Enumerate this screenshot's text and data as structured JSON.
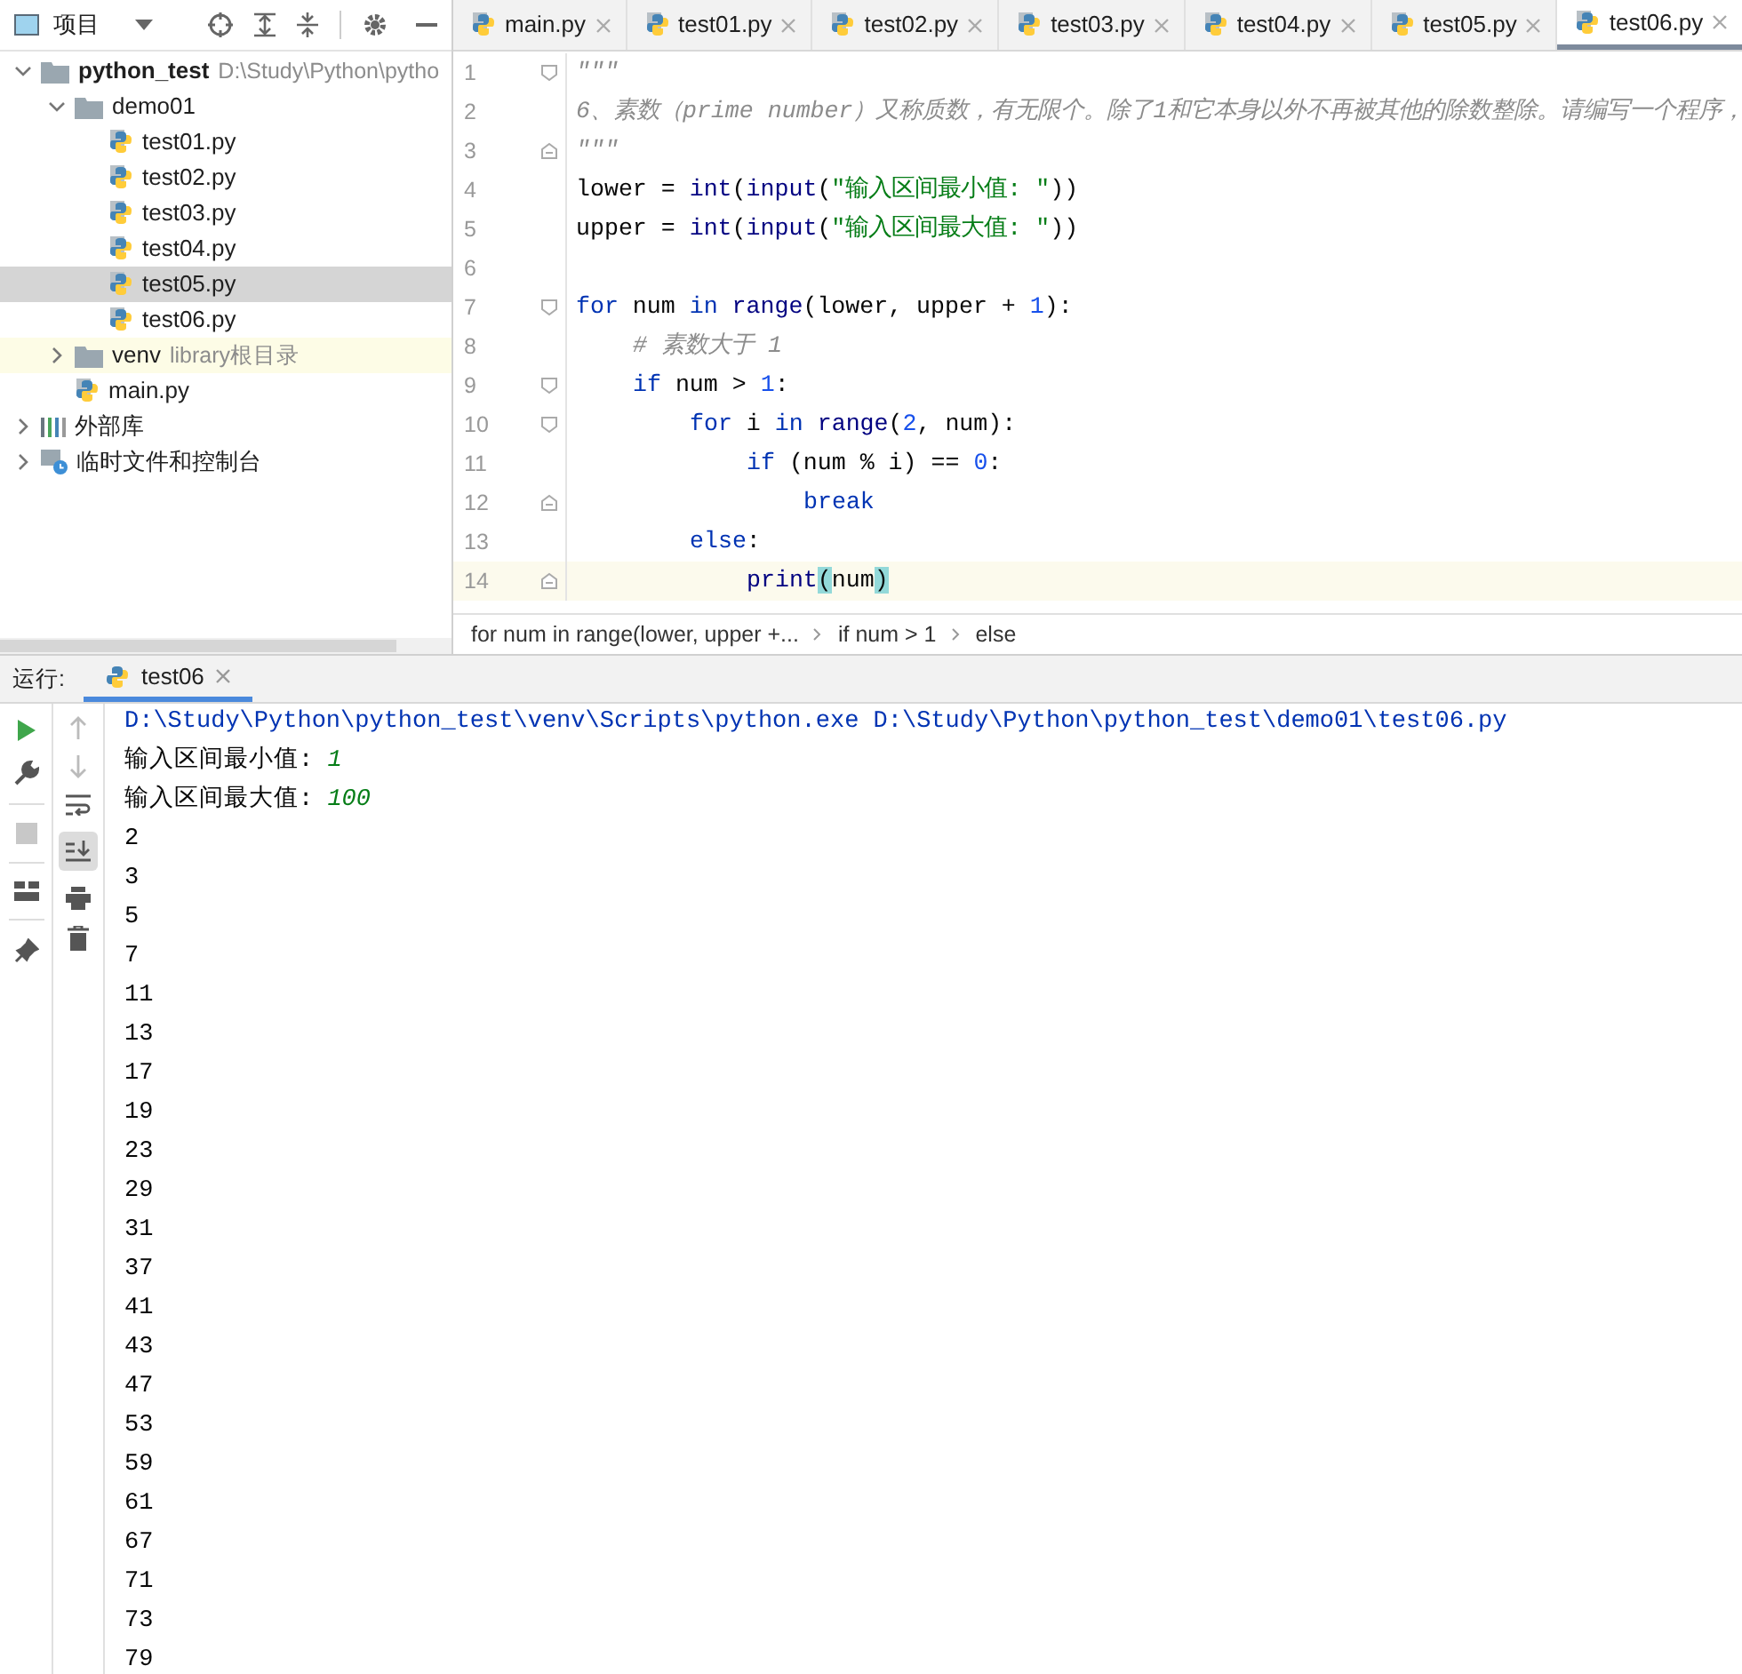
{
  "project_panel": {
    "title": "项目",
    "tree": [
      {
        "label": "python_test",
        "hint": "D:\\Study\\Python\\pytho",
        "kind": "project",
        "expanded": true,
        "selected": false,
        "children": [
          {
            "label": "demo01",
            "kind": "folder",
            "expanded": true,
            "selected": false,
            "children": [
              {
                "label": "test01.py",
                "kind": "python",
                "selected": false
              },
              {
                "label": "test02.py",
                "kind": "python",
                "selected": false
              },
              {
                "label": "test03.py",
                "kind": "python",
                "selected": false
              },
              {
                "label": "test04.py",
                "kind": "python",
                "selected": false
              },
              {
                "label": "test05.py",
                "kind": "python",
                "selected": true
              },
              {
                "label": "test06.py",
                "kind": "python",
                "selected": false
              }
            ]
          },
          {
            "label": "venv",
            "hint": "library根目录",
            "kind": "library",
            "expanded": false,
            "selected": false
          },
          {
            "label": "main.py",
            "kind": "python",
            "selected": false
          }
        ]
      },
      {
        "label": "外部库",
        "kind": "ext-lib",
        "expanded": false,
        "selected": false
      },
      {
        "label": "临时文件和控制台",
        "kind": "scratch",
        "expanded": false,
        "selected": false
      }
    ]
  },
  "editor_tabs": [
    {
      "label": "main.py",
      "selected": false
    },
    {
      "label": "test01.py",
      "selected": false
    },
    {
      "label": "test02.py",
      "selected": false
    },
    {
      "label": "test03.py",
      "selected": false
    },
    {
      "label": "test04.py",
      "selected": false
    },
    {
      "label": "test05.py",
      "selected": false
    },
    {
      "label": "test06.py",
      "selected": true
    }
  ],
  "code_lines": [
    {
      "number": "1",
      "fold_start": true,
      "tokens": [
        {
          "kind": "doc",
          "text": "\"\"\""
        }
      ]
    },
    {
      "number": "2",
      "tokens": [
        {
          "kind": "doc",
          "text": "6、素数（prime number）又称质数，有无限个。除了1和它本身以外不再被其他的除数整除。请编写一个程序，"
        }
      ]
    },
    {
      "number": "3",
      "fold_end": true,
      "tokens": [
        {
          "kind": "doc",
          "text": "\"\"\""
        }
      ]
    },
    {
      "number": "4",
      "tokens": [
        {
          "kind": "plain",
          "text": "lower = "
        },
        {
          "kind": "builtin",
          "text": "int"
        },
        {
          "kind": "plain",
          "text": "("
        },
        {
          "kind": "builtin",
          "text": "input"
        },
        {
          "kind": "plain",
          "text": "("
        },
        {
          "kind": "str",
          "text": "\"输入区间最小值: \""
        },
        {
          "kind": "plain",
          "text": "))"
        }
      ]
    },
    {
      "number": "5",
      "tokens": [
        {
          "kind": "plain",
          "text": "upper = "
        },
        {
          "kind": "builtin",
          "text": "int"
        },
        {
          "kind": "plain",
          "text": "("
        },
        {
          "kind": "builtin",
          "text": "input"
        },
        {
          "kind": "plain",
          "text": "("
        },
        {
          "kind": "str",
          "text": "\"输入区间最大值: \""
        },
        {
          "kind": "plain",
          "text": "))"
        }
      ]
    },
    {
      "number": "6"
    },
    {
      "number": "7",
      "fold_start": true,
      "tokens": [
        {
          "kind": "kw",
          "text": "for"
        },
        {
          "kind": "plain",
          "text": " num "
        },
        {
          "kind": "kw",
          "text": "in"
        },
        {
          "kind": "builtin",
          "text": " range"
        },
        {
          "kind": "plain",
          "text": "(lower, upper + "
        },
        {
          "kind": "num",
          "text": "1"
        },
        {
          "kind": "plain",
          "text": "):"
        }
      ],
      "children": [
        {
          "number": "8",
          "tokens": [
            {
              "kind": "cmt",
              "text": "# 素数大于 1"
            }
          ]
        },
        {
          "number": "9",
          "fold_start": true,
          "tokens": [
            {
              "kind": "kw",
              "text": "if"
            },
            {
              "kind": "plain",
              "text": " num > "
            },
            {
              "kind": "num",
              "text": "1"
            },
            {
              "kind": "plain",
              "text": ":"
            }
          ],
          "children": [
            {
              "number": "10",
              "fold_start": true,
              "tokens": [
                {
                  "kind": "kw",
                  "text": "for"
                },
                {
                  "kind": "plain",
                  "text": " i "
                },
                {
                  "kind": "kw",
                  "text": "in"
                },
                {
                  "kind": "builtin",
                  "text": " range"
                },
                {
                  "kind": "plain",
                  "text": "("
                },
                {
                  "kind": "num",
                  "text": "2"
                },
                {
                  "kind": "plain",
                  "text": ", num):"
                }
              ],
              "children": [
                {
                  "number": "11",
                  "tokens": [
                    {
                      "kind": "kw",
                      "text": "if"
                    },
                    {
                      "kind": "plain",
                      "text": " (num % i) == "
                    },
                    {
                      "kind": "num",
                      "text": "0"
                    },
                    {
                      "kind": "plain",
                      "text": ":"
                    }
                  ],
                  "children": [
                    {
                      "number": "12",
                      "fold_end": true,
                      "tokens": [
                        {
                          "kind": "kw",
                          "text": "break"
                        }
                      ]
                    }
                  ]
                }
              ]
            },
            {
              "number": "13",
              "tokens": [
                {
                  "kind": "kw",
                  "text": "else"
                },
                {
                  "kind": "plain",
                  "text": ":"
                }
              ],
              "children": [
                {
                  "number": "14",
                  "fold_end": true,
                  "current": true,
                  "tokens": [
                    {
                      "kind": "builtin",
                      "text": "print"
                    },
                    {
                      "kind": "match",
                      "text": "("
                    },
                    {
                      "kind": "plain",
                      "text": "num"
                    },
                    {
                      "kind": "match",
                      "text": ")"
                    }
                  ]
                }
              ]
            }
          ]
        }
      ]
    }
  ],
  "breadcrumbs": [
    "for num in range(lower, upper +...",
    "if num > 1",
    "else"
  ],
  "run_panel": {
    "label": "运行:",
    "tab": "test06",
    "console": [
      {
        "kind": "command",
        "text": "D:\\Study\\Python\\python_test\\venv\\Scripts\\python.exe D:\\Study\\Python\\python_test\\demo01\\test06.py"
      },
      {
        "kind": "prompt",
        "text": "输入区间最小值: ",
        "input": "1"
      },
      {
        "kind": "prompt",
        "text": "输入区间最大值: ",
        "input": "100"
      },
      {
        "kind": "output",
        "text": "2"
      },
      {
        "kind": "output",
        "text": "3"
      },
      {
        "kind": "output",
        "text": "5"
      },
      {
        "kind": "output",
        "text": "7"
      },
      {
        "kind": "output",
        "text": "11"
      },
      {
        "kind": "output",
        "text": "13"
      },
      {
        "kind": "output",
        "text": "17"
      },
      {
        "kind": "output",
        "text": "19"
      },
      {
        "kind": "output",
        "text": "23"
      },
      {
        "kind": "output",
        "text": "29"
      },
      {
        "kind": "output",
        "text": "31"
      },
      {
        "kind": "output",
        "text": "37"
      },
      {
        "kind": "output",
        "text": "41"
      },
      {
        "kind": "output",
        "text": "43"
      },
      {
        "kind": "output",
        "text": "47"
      },
      {
        "kind": "output",
        "text": "53"
      },
      {
        "kind": "output",
        "text": "59"
      },
      {
        "kind": "output",
        "text": "61"
      },
      {
        "kind": "output",
        "text": "67"
      },
      {
        "kind": "output",
        "text": "71"
      },
      {
        "kind": "output",
        "text": "73"
      },
      {
        "kind": "output",
        "text": "79"
      }
    ]
  }
}
